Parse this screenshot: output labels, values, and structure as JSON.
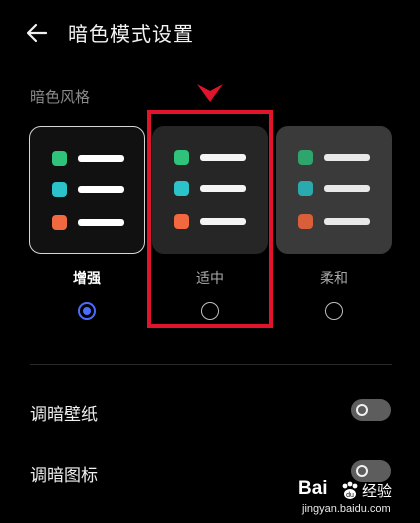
{
  "header": {
    "title": "暗色模式设置"
  },
  "section": {
    "label": "暗色风格"
  },
  "options": [
    {
      "label": "增强",
      "selected": true
    },
    {
      "label": "适中",
      "selected": false
    },
    {
      "label": "柔和",
      "selected": false
    }
  ],
  "settings": [
    {
      "label": "调暗壁纸",
      "on": false
    },
    {
      "label": "调暗图标",
      "on": false
    }
  ],
  "colors": {
    "green": "#2fc27a",
    "cyan": "#2bc3c9",
    "orange": "#f2693f",
    "radio_accent": "#4d6bff",
    "highlight": "#e0142a"
  },
  "watermark": {
    "logo": "Bai",
    "text": "经验",
    "url": "jingyan.baidu.com"
  }
}
